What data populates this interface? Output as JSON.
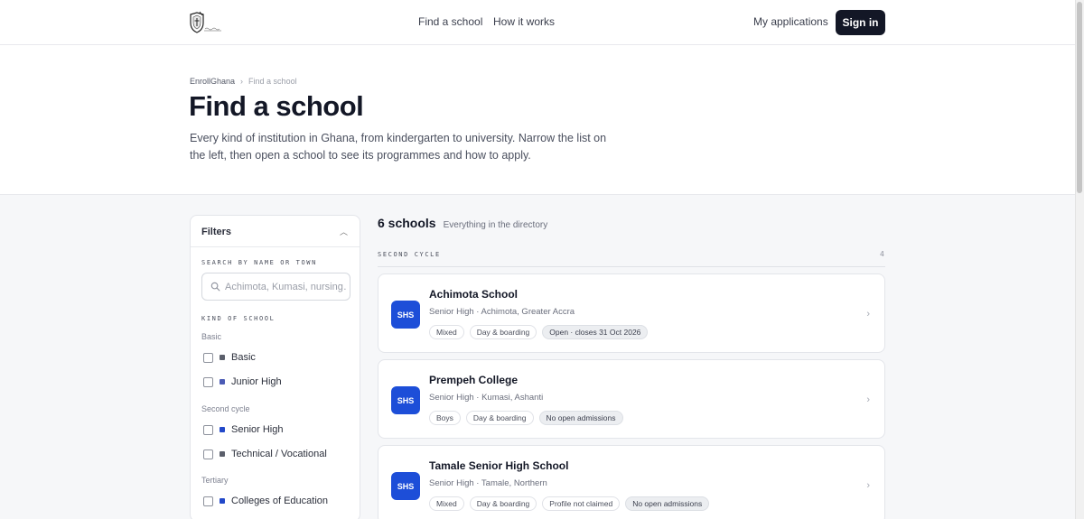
{
  "nav": {
    "logo": "school-crest-logo",
    "links": {
      "find": "Find a school",
      "how": "How it works"
    },
    "my_applications": "My applications",
    "sign_in": "Sign in"
  },
  "breadcrumb": {
    "root": "EnrollGhana",
    "current": "Find a school"
  },
  "hero": {
    "title": "Find a school",
    "subtitle": "Every kind of institution in Ghana, from kindergarten to university. Narrow the list on the left, then open a school to see its programmes and how to apply."
  },
  "filters": {
    "title": "Filters",
    "search_label": "SEARCH BY NAME OR TOWN",
    "search_placeholder": "Achimota, Kumasi, nursing…",
    "search_value": "",
    "kind_label": "KIND OF SCHOOL",
    "groups": [
      {
        "label": "Basic",
        "items": [
          {
            "label": "Basic",
            "color": "#5b5f6b",
            "checked": false
          },
          {
            "label": "Junior High",
            "color": "#4b5bb5",
            "checked": false
          }
        ]
      },
      {
        "label": "Second cycle",
        "items": [
          {
            "label": "Senior High",
            "color": "#2248c9",
            "checked": false
          },
          {
            "label": "Technical / Vocational",
            "color": "#5b5f6b",
            "checked": false
          }
        ]
      },
      {
        "label": "Tertiary",
        "items": [
          {
            "label": "Colleges of Education",
            "color": "#2248c9",
            "checked": false
          }
        ]
      }
    ]
  },
  "results": {
    "count": "6 schools",
    "scope": "Everything in the directory",
    "section": {
      "label": "SECOND CYCLE",
      "count": "4"
    },
    "schools": [
      {
        "badge": "SHS",
        "name": "Achimota School",
        "meta": "Senior High · Achimota, Greater Accra",
        "tags": [
          "Mixed",
          "Day & boarding"
        ],
        "status": [
          "Open · closes 31 Oct 2026"
        ]
      },
      {
        "badge": "SHS",
        "name": "Prempeh College",
        "meta": "Senior High · Kumasi, Ashanti",
        "tags": [
          "Boys",
          "Day & boarding"
        ],
        "status": [
          "No open admissions"
        ]
      },
      {
        "badge": "SHS",
        "name": "Tamale Senior High School",
        "meta": "Senior High · Tamale, Northern",
        "tags": [
          "Mixed",
          "Day & boarding",
          "Profile not claimed"
        ],
        "status": [
          "No open admissions"
        ]
      }
    ]
  }
}
